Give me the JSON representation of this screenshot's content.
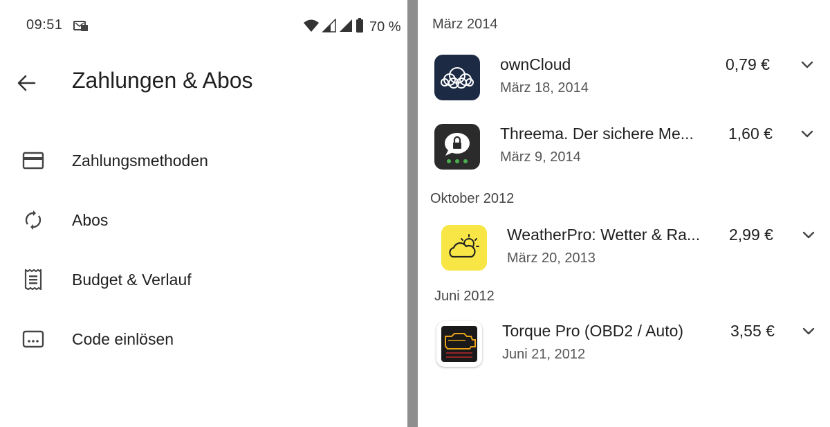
{
  "status_bar": {
    "time": "09:51",
    "battery": "70 %",
    "icons": [
      "notification-icon",
      "wifi-icon",
      "signal-icon",
      "signal-icon",
      "battery-icon"
    ]
  },
  "header": {
    "title": "Zahlungen & Abos",
    "back_icon": "arrow-back-icon"
  },
  "menu": [
    {
      "label": "Zahlungsmethoden",
      "icon": "credit-card-icon"
    },
    {
      "label": "Abos",
      "icon": "sync-icon"
    },
    {
      "label": "Budget & Verlauf",
      "icon": "receipt-icon"
    },
    {
      "label": "Code einlösen",
      "icon": "redeem-code-icon"
    }
  ],
  "history": {
    "sections": [
      {
        "header": "März 2014",
        "items": [
          {
            "name": "ownCloud",
            "date": "März 18, 2014",
            "price": "0,79 €",
            "icon": "owncloud-icon"
          },
          {
            "name": "Threema. Der sichere Me...",
            "date": "März 9, 2014",
            "price": "1,60 €",
            "icon": "threema-icon"
          }
        ]
      },
      {
        "header": "Oktober 2012",
        "items": [
          {
            "name": "WeatherPro: Wetter & Ra...",
            "date": "März 20, 2013",
            "price": "2,99 €",
            "icon": "weatherpro-icon"
          }
        ]
      },
      {
        "header": "Juni 2012",
        "items": [
          {
            "name": "Torque Pro (OBD2 / Auto)",
            "date": "Juni 21, 2012",
            "price": "3,55 €",
            "icon": "torque-obd-icon"
          }
        ]
      }
    ]
  },
  "colors": {
    "divider": "#8e8e8e",
    "owncloud_bg": "#1d2a44",
    "threema_bg": "#2b2b2b",
    "threema_dots": "#4caf50",
    "weather_bg": "#f7e646",
    "torque_bg": "#1a1a1a"
  }
}
